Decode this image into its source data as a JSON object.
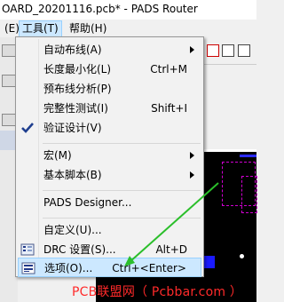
{
  "window": {
    "title": "OARD_20201116.pcb* - PADS Router"
  },
  "menubar": {
    "edit": "(E)",
    "tools": "工具(T)",
    "help": "帮助(H)"
  },
  "menu": {
    "items": [
      {
        "label": "自动布线(A)",
        "shortcut": "",
        "submenu": true,
        "icon": ""
      },
      {
        "label": "长度最小化(L)",
        "shortcut": "Ctrl+M",
        "submenu": false,
        "icon": ""
      },
      {
        "label": "预布线分析(P)",
        "shortcut": "",
        "submenu": false,
        "icon": ""
      },
      {
        "label": "完整性测试(I)",
        "shortcut": "Shift+I",
        "submenu": false,
        "icon": ""
      },
      {
        "label": "验证设计(V)",
        "shortcut": "",
        "submenu": false,
        "icon": "check-icon"
      },
      {
        "label": "宏(M)",
        "shortcut": "",
        "submenu": true,
        "icon": ""
      },
      {
        "label": "基本脚本(B)",
        "shortcut": "",
        "submenu": true,
        "icon": ""
      },
      {
        "label": "PADS Designer...",
        "shortcut": "",
        "submenu": false,
        "icon": ""
      },
      {
        "label": "自定义(U)...",
        "shortcut": "",
        "submenu": false,
        "icon": ""
      },
      {
        "label": "DRC 设置(S)...",
        "shortcut": "Alt+D",
        "submenu": false,
        "icon": "drc-icon"
      },
      {
        "label": "选项(O)...",
        "shortcut": "Ctrl+<Enter>",
        "submenu": false,
        "icon": "options-icon",
        "selected": true
      }
    ]
  },
  "watermark": "PCB联盟网（ Pcbbar.com ）",
  "colors": {
    "highlight": "#cce8ff",
    "highlight_border": "#99d1ff",
    "arrow": "#2bbf2b",
    "watermark": "#ff2a2a",
    "pad": "#1a1aff"
  }
}
